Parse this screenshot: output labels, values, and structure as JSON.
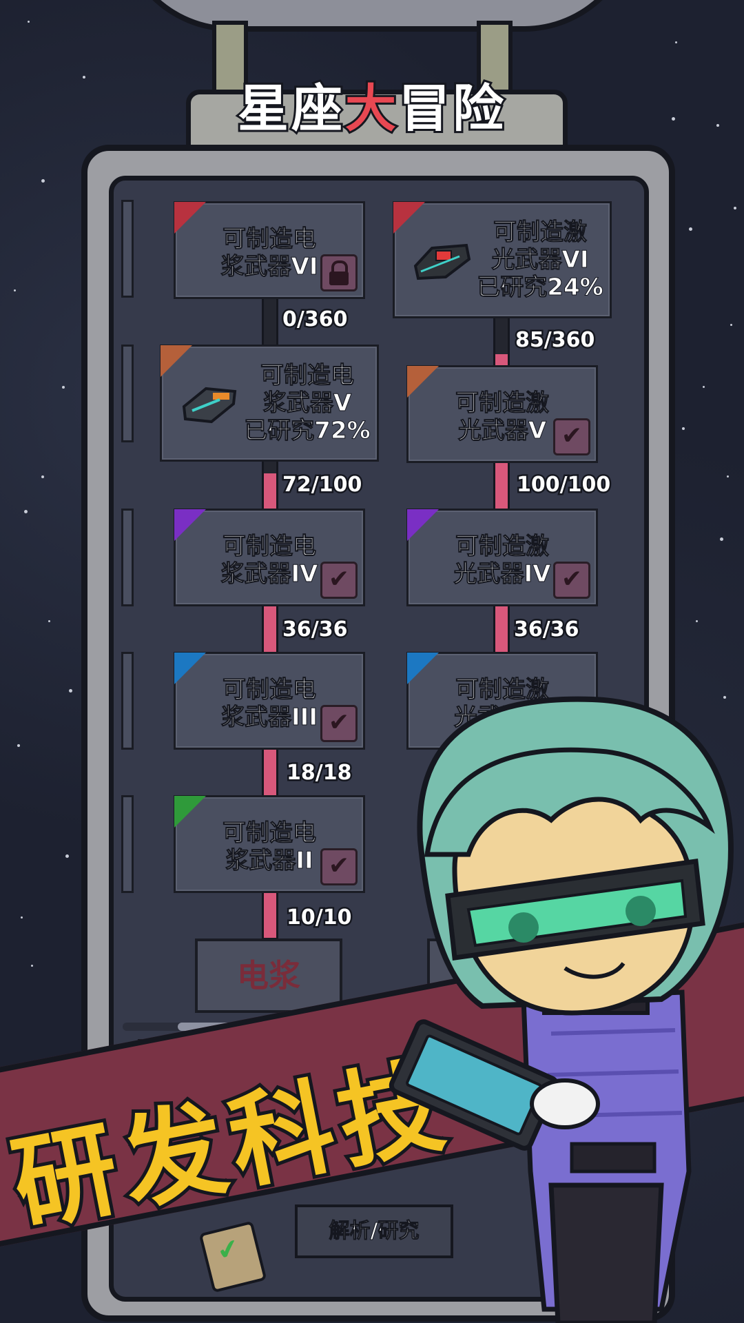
{
  "logo": {
    "part1": "星座",
    "accent": "大",
    "part2": "冒险"
  },
  "tech_tree": {
    "plasma": [
      {
        "name_line1": "可制造电",
        "name_line2": "浆武器VI",
        "status": "",
        "state": "locked",
        "tier_color": "#b8323f",
        "progress_text": "0/360",
        "progress": 0.0
      },
      {
        "name_line1": "可制造电",
        "name_line2": "浆武器V",
        "status": "已研究72%",
        "state": "researching",
        "tier_color": "#b5603a",
        "progress_text": "72/100",
        "progress": 0.72
      },
      {
        "name_line1": "可制造电",
        "name_line2": "浆武器IV",
        "status": "",
        "state": "done",
        "tier_color": "#7a2fc4",
        "progress_text": "36/36",
        "progress": 1.0
      },
      {
        "name_line1": "可制造电",
        "name_line2": "浆武器III",
        "status": "",
        "state": "done",
        "tier_color": "#1c78c2",
        "progress_text": "18/18",
        "progress": 1.0
      },
      {
        "name_line1": "可制造电",
        "name_line2": "浆武器II",
        "status": "",
        "state": "done",
        "tier_color": "#2f9a3a",
        "progress_text": "10/10",
        "progress": 1.0
      }
    ],
    "laser": [
      {
        "name_line1": "可制造激",
        "name_line2": "光武器VI",
        "status": "已研究24%",
        "state": "researching",
        "tier_color": "#b8323f",
        "progress_text": "85/360",
        "progress": 0.24
      },
      {
        "name_line1": "可制造激",
        "name_line2": "光武器V",
        "status": "",
        "state": "done",
        "tier_color": "#b5603a",
        "progress_text": "100/100",
        "progress": 1.0
      },
      {
        "name_line1": "可制造激",
        "name_line2": "光武器IV",
        "status": "",
        "state": "done",
        "tier_color": "#7a2fc4",
        "progress_text": "36/36",
        "progress": 1.0
      },
      {
        "name_line1": "可制造激",
        "name_line2": "光武器III",
        "status": "",
        "state": "done",
        "tier_color": "#1c78c2"
      },
      {
        "name_line1": "",
        "name_line2": "",
        "status": "",
        "state": "hidden",
        "tier_color": "#2f9a3a"
      }
    ]
  },
  "category_button": "电浆",
  "research_button": "解析/研究",
  "banner": "研发科技",
  "icons": {
    "lock": "lock-icon",
    "check": "check-icon",
    "gear": "gear-icon",
    "clipboard": "clipboard-check-icon"
  }
}
